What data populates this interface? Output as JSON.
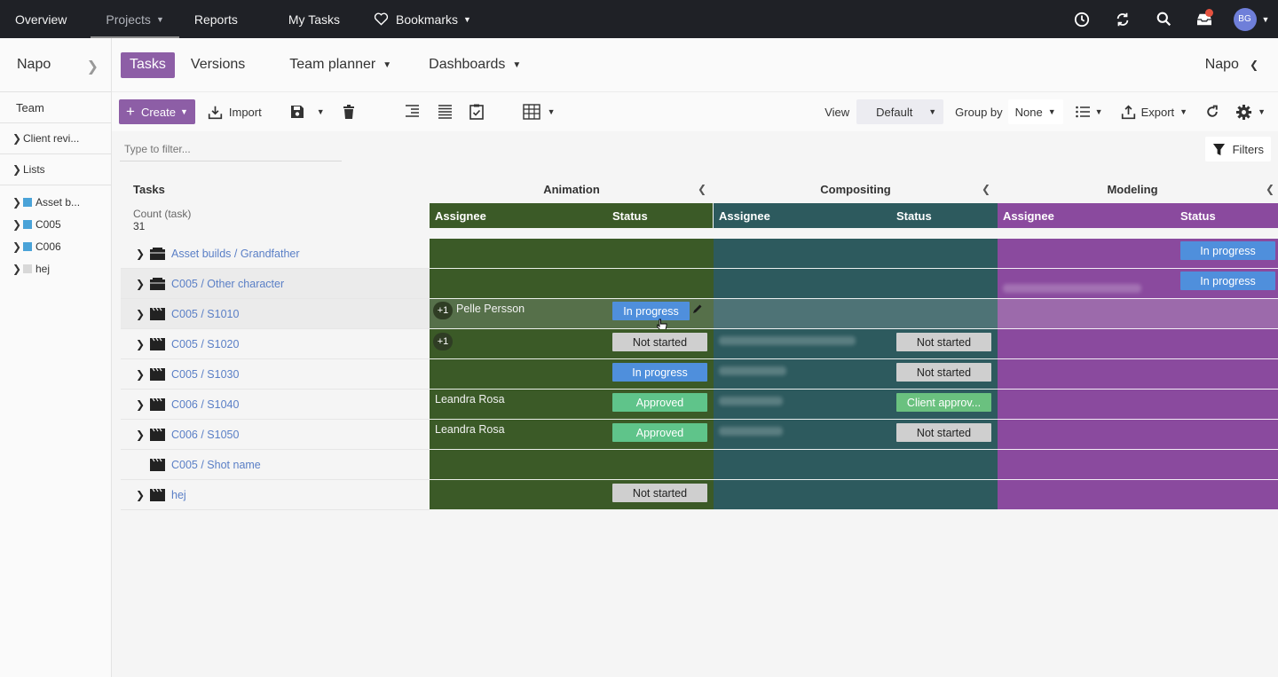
{
  "topnav": {
    "items": [
      {
        "label": "Overview"
      },
      {
        "label": "Projects"
      },
      {
        "label": "Reports"
      },
      {
        "label": "My Tasks"
      },
      {
        "label": "Bookmarks"
      }
    ],
    "avatar_initials": "BG"
  },
  "sidebar": {
    "project": "Napo",
    "team": "Team",
    "client_review": "Client revi...",
    "lists": "Lists",
    "tree": [
      {
        "label": "Asset b...",
        "color": "#4aa3d8"
      },
      {
        "label": "C005",
        "color": "#4aa3d8"
      },
      {
        "label": "C006",
        "color": "#4aa3d8"
      },
      {
        "label": "hej",
        "color": "#d8d8d8"
      }
    ]
  },
  "subhead": {
    "tabs": [
      {
        "label": "Tasks"
      },
      {
        "label": "Versions"
      },
      {
        "label": "Team planner"
      },
      {
        "label": "Dashboards"
      }
    ],
    "project_right": "Napo"
  },
  "toolbar": {
    "create": "Create",
    "import": "Import",
    "view_label": "View",
    "view_value": "Default",
    "groupby_label": "Group by",
    "groupby_value": "None",
    "export": "Export",
    "filters": "Filters"
  },
  "filter": {
    "placeholder": "Type to filter..."
  },
  "grid": {
    "tasks_header": "Tasks",
    "count_label": "Count (task)",
    "count_value": "31",
    "groups": [
      {
        "name": "Animation",
        "color": "#3b5a27"
      },
      {
        "name": "Compositing",
        "color": "#2d5a5e"
      },
      {
        "name": "Modeling",
        "color": "#8a4a9e"
      }
    ],
    "col_assignee": "Assignee",
    "col_status": "Status",
    "rows": [
      {
        "name": "Asset builds / Grandfather",
        "anim_assignee": "",
        "anim_status": "",
        "comp_status": "",
        "model_status": "In progress"
      },
      {
        "name": "C005 / Other character",
        "anim_assignee": "",
        "anim_status": "",
        "comp_status": "",
        "model_status": "In progress"
      },
      {
        "name": "C005 / S1010",
        "anim_plus": "+1",
        "anim_assignee": "Pelle Persson",
        "anim_status": "In progress",
        "comp_status": "",
        "model_status": ""
      },
      {
        "name": "C005 / S1020",
        "anim_plus": "+1",
        "anim_assignee": "",
        "anim_status": "Not started",
        "comp_status": "Not started",
        "model_status": ""
      },
      {
        "name": "C005 / S1030",
        "anim_assignee": "",
        "anim_status": "In progress",
        "comp_status": "Not started",
        "model_status": ""
      },
      {
        "name": "C006 / S1040",
        "anim_assignee": "Leandra Rosa",
        "anim_status": "Approved",
        "comp_status": "Client approv...",
        "model_status": ""
      },
      {
        "name": "C006 / S1050",
        "anim_assignee": "Leandra Rosa",
        "anim_status": "Approved",
        "comp_status": "Not started",
        "model_status": ""
      },
      {
        "name": "C005 / Shot name",
        "anim_assignee": "",
        "anim_status": "",
        "comp_status": "",
        "model_status": ""
      },
      {
        "name": "hej",
        "anim_assignee": "",
        "anim_status": "Not started",
        "comp_status": "",
        "model_status": ""
      }
    ]
  }
}
